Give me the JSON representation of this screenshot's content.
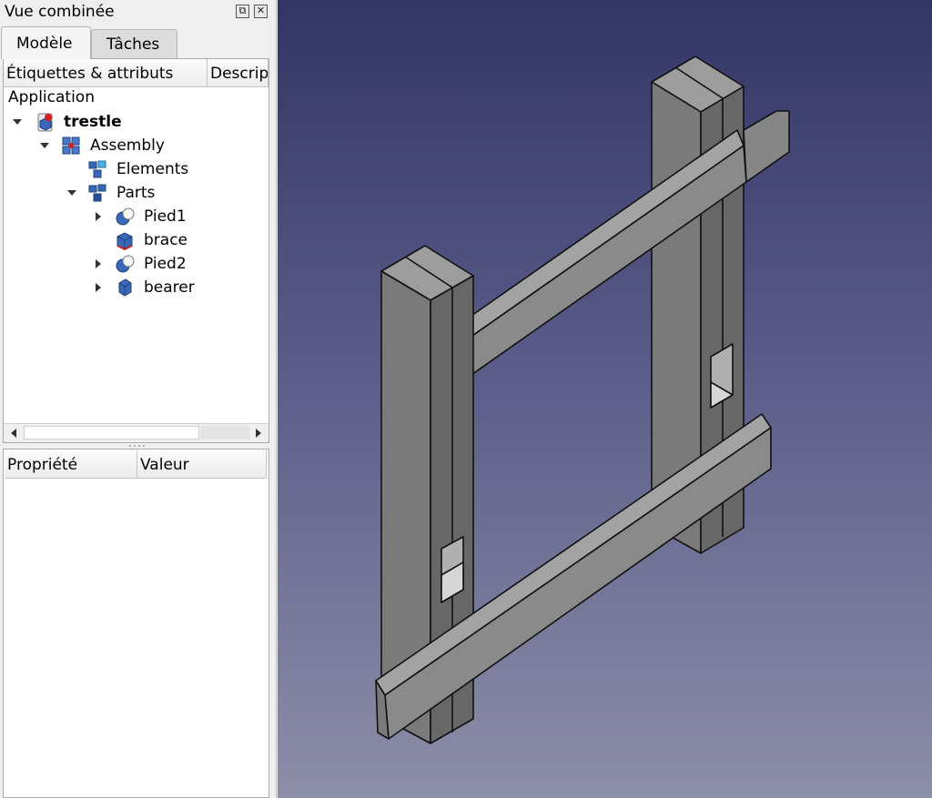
{
  "panel": {
    "title": "Vue combinée",
    "float_icon": "⧉",
    "close_icon": "✕"
  },
  "tabs": [
    {
      "label": "Modèle",
      "active": true
    },
    {
      "label": "Tâches",
      "active": false
    }
  ],
  "tree": {
    "headers": [
      "Étiquettes & attributs",
      "Descrip"
    ],
    "root_label": "Application",
    "items": [
      {
        "label": "trestle",
        "icon": "document-icon",
        "expander": "down",
        "bold": true
      },
      {
        "label": "Assembly",
        "icon": "assembly-icon",
        "expander": "down"
      },
      {
        "label": "Elements",
        "icon": "elements-group-icon",
        "expander": "none"
      },
      {
        "label": "Parts",
        "icon": "parts-group-icon",
        "expander": "down"
      },
      {
        "label": "Pied1",
        "icon": "link-part-icon",
        "expander": "right"
      },
      {
        "label": "brace",
        "icon": "part-cube-icon",
        "expander": "none"
      },
      {
        "label": "Pied2",
        "icon": "link-part-icon",
        "expander": "right"
      },
      {
        "label": "bearer",
        "icon": "part-body-icon",
        "expander": "right"
      }
    ]
  },
  "properties": {
    "headers": [
      "Propriété",
      "Valeur"
    ]
  },
  "viewport": {
    "colors": {
      "top": "#333566",
      "bottom": "#8d8ea8",
      "face_front": "#7a7a7a",
      "face_side": "#676767",
      "face_top": "#9d9d9d"
    }
  }
}
